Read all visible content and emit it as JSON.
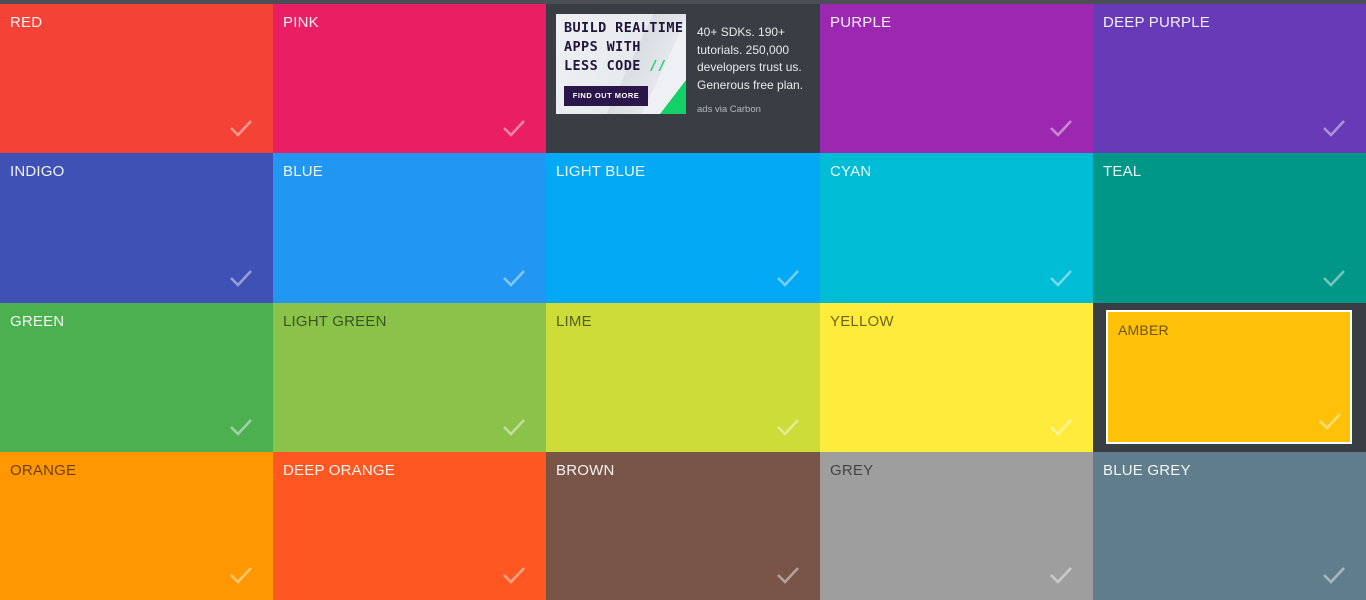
{
  "colors": [
    {
      "label": "RED",
      "color": "#f44336",
      "theme": "light"
    },
    {
      "label": "PINK",
      "color": "#e91e63",
      "theme": "light"
    },
    {
      "label": "",
      "color": "#383e44",
      "theme": "light",
      "ad": true
    },
    {
      "label": "PURPLE",
      "color": "#9c27b0",
      "theme": "light"
    },
    {
      "label": "DEEP PURPLE",
      "color": "#673ab7",
      "theme": "light"
    },
    {
      "label": "INDIGO",
      "color": "#3f51b5",
      "theme": "light"
    },
    {
      "label": "BLUE",
      "color": "#2196f3",
      "theme": "light"
    },
    {
      "label": "LIGHT BLUE",
      "color": "#03a9f4",
      "theme": "light"
    },
    {
      "label": "CYAN",
      "color": "#00bcd4",
      "theme": "light"
    },
    {
      "label": "TEAL",
      "color": "#009688",
      "theme": "light"
    },
    {
      "label": "GREEN",
      "color": "#4caf50",
      "theme": "light"
    },
    {
      "label": "LIGHT GREEN",
      "color": "#8bc34a",
      "theme": "dark"
    },
    {
      "label": "LIME",
      "color": "#cddc39",
      "theme": "dark"
    },
    {
      "label": "YELLOW",
      "color": "#ffeb3b",
      "theme": "dark"
    },
    {
      "label": "AMBER",
      "color": "#ffc107",
      "theme": "dark",
      "selected": true
    },
    {
      "label": "ORANGE",
      "color": "#ff9800",
      "theme": "dark"
    },
    {
      "label": "DEEP ORANGE",
      "color": "#ff5722",
      "theme": "light"
    },
    {
      "label": "BROWN",
      "color": "#795548",
      "theme": "light"
    },
    {
      "label": "GREY",
      "color": "#9e9e9e",
      "theme": "dark"
    },
    {
      "label": "BLUE GREY",
      "color": "#607d8b",
      "theme": "light"
    }
  ],
  "ad": {
    "headline_line1": "BUILD REALTIME",
    "headline_line2": "APPS WITH",
    "headline_line3": "LESS CODE",
    "headline_slashes": "//",
    "cta": "FIND OUT MORE",
    "body": "40+ SDKs. 190+ tutorials. 250,000 developers trust us. Generous free plan.",
    "via": "ads via Carbon"
  },
  "icons": {
    "check": "check-icon"
  }
}
